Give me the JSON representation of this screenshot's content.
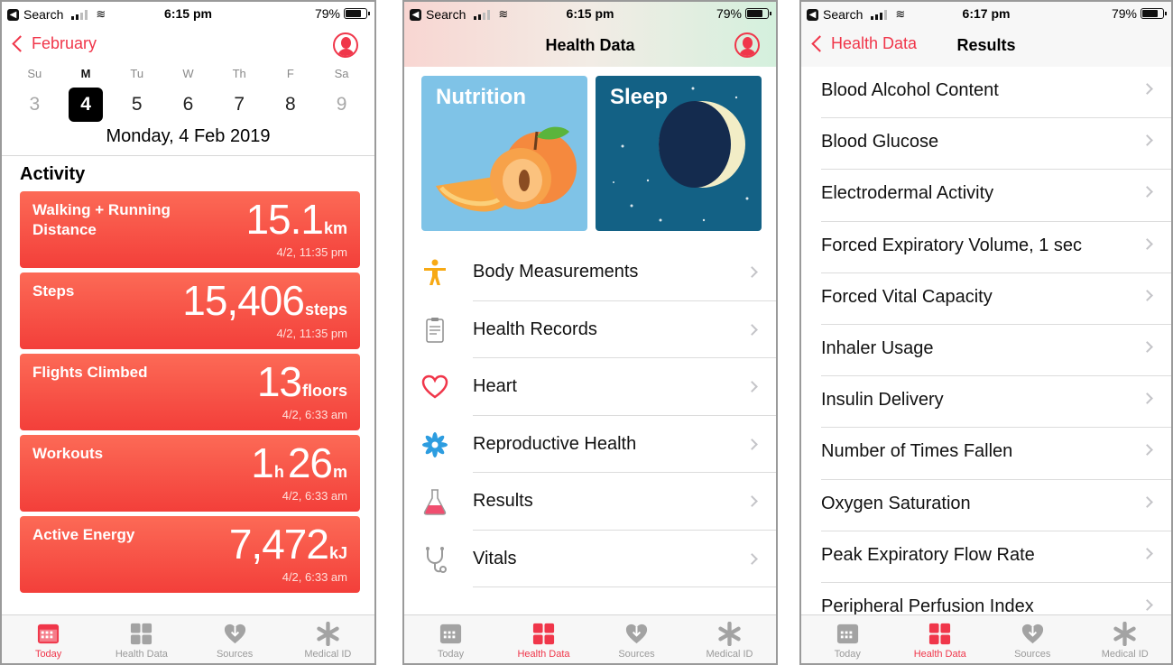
{
  "status_left": [
    {
      "back_label": "Search",
      "time": "6:15 pm",
      "battery": "79%"
    },
    {
      "back_label": "Search",
      "time": "6:15 pm",
      "battery": "79%"
    },
    {
      "back_label": "Search",
      "time": "6:17 pm",
      "battery": "79%"
    }
  ],
  "today": {
    "back_label": "February",
    "weekdays": [
      "Su",
      "M",
      "Tu",
      "W",
      "Th",
      "F",
      "Sa"
    ],
    "dates": [
      "3",
      "4",
      "5",
      "6",
      "7",
      "8",
      "9"
    ],
    "full_date": "Monday, 4 Feb 2019",
    "section_title": "Activity",
    "cards": [
      {
        "name": "Walking + Running Distance",
        "value": "15.1",
        "unit": "km",
        "timestamp": "4/2, 11:35 pm"
      },
      {
        "name": "Steps",
        "value": "15,406",
        "unit": "steps",
        "timestamp": "4/2, 11:35 pm"
      },
      {
        "name": "Flights Climbed",
        "value": "13",
        "unit": "floors",
        "timestamp": "4/2, 6:33 am"
      },
      {
        "name": "Workouts",
        "value_h": "1",
        "unit_h": "h",
        "value_m": "26",
        "unit_m": "m",
        "timestamp": "4/2, 6:33 am"
      },
      {
        "name": "Active Energy",
        "value": "7,472",
        "unit": "kJ",
        "timestamp": "4/2, 6:33 am"
      }
    ]
  },
  "health_data": {
    "title": "Health Data",
    "tiles": {
      "nutrition": "Nutrition",
      "sleep": "Sleep"
    },
    "categories": [
      {
        "label": "Body Measurements",
        "icon": "body-icon"
      },
      {
        "label": "Health Records",
        "icon": "clipboard-icon"
      },
      {
        "label": "Heart",
        "icon": "heart-icon"
      },
      {
        "label": "Reproductive Health",
        "icon": "flower-icon"
      },
      {
        "label": "Results",
        "icon": "flask-icon"
      },
      {
        "label": "Vitals",
        "icon": "stethoscope-icon"
      }
    ]
  },
  "results": {
    "back_label": "Health Data",
    "title": "Results",
    "items": [
      "Blood Alcohol Content",
      "Blood Glucose",
      "Electrodermal Activity",
      "Forced Expiratory Volume, 1 sec",
      "Forced Vital Capacity",
      "Inhaler Usage",
      "Insulin Delivery",
      "Number of Times Fallen",
      "Oxygen Saturation",
      "Peak Expiratory Flow Rate",
      "Peripheral Perfusion Index"
    ]
  },
  "tabs": [
    "Today",
    "Health Data",
    "Sources",
    "Medical ID"
  ],
  "colors": {
    "accent": "#f0364a",
    "card": "#f5473d",
    "nutrition": "#7fc3e7",
    "sleep": "#136185"
  }
}
